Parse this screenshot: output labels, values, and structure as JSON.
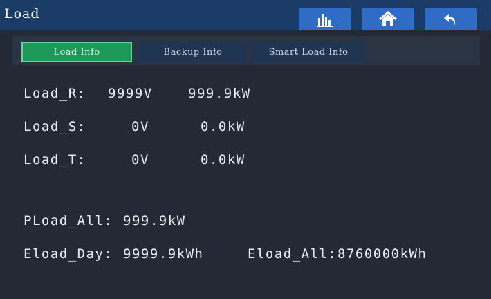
{
  "header": {
    "title": "Load"
  },
  "toolbar": {
    "chart_icon": "bar-chart-icon",
    "home_icon": "home-icon",
    "back_icon": "back-arrow-icon"
  },
  "tabs": [
    {
      "label": "Load Info",
      "active": true
    },
    {
      "label": "Backup Info",
      "active": false
    },
    {
      "label": "Smart Load Info",
      "active": false
    }
  ],
  "phases": [
    {
      "label": "Load_R:",
      "voltage": "9999V",
      "power": "999.9kW"
    },
    {
      "label": "Load_S:",
      "voltage": "0V",
      "power": "0.0kW"
    },
    {
      "label": "Load_T:",
      "voltage": "0V",
      "power": "0.0kW"
    }
  ],
  "totals": {
    "pload_all_label": "PLoad_All:",
    "pload_all_value": "999.9kW",
    "eload_day_label": "Eload_Day:",
    "eload_day_value": "9999.9kWh",
    "eload_all_label": "Eload_All:",
    "eload_all_value": "8760000kWh"
  },
  "colors": {
    "background": "#242a35",
    "header": "#1a3c66",
    "button": "#2f6cc6",
    "active_tab": "#1d9a5a",
    "inactive_tab": "#203552"
  }
}
